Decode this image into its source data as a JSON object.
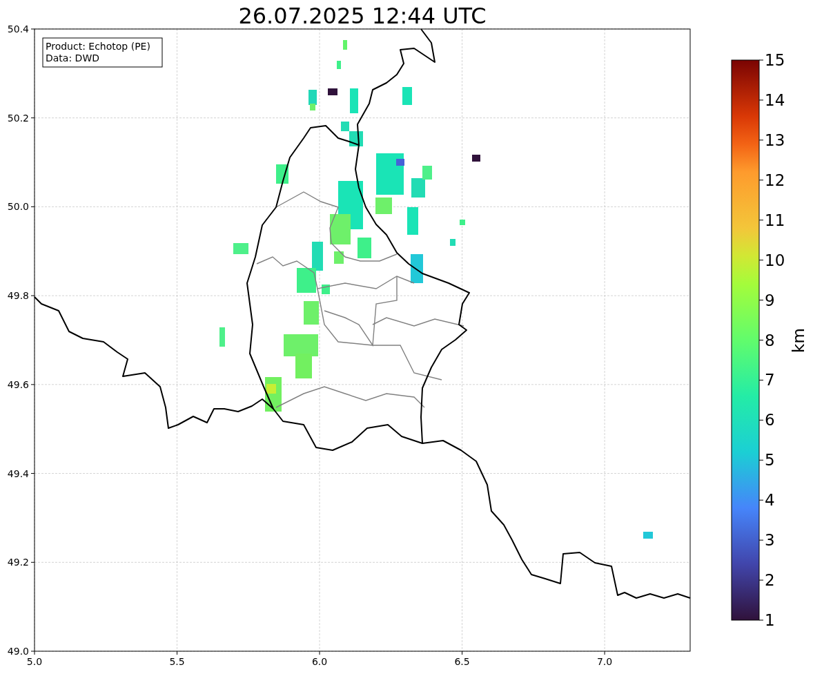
{
  "title": "26.07.2025 12:44 UTC",
  "legend": [
    "Product: Echotop (PE)",
    "Data: DWD"
  ],
  "x_ticks": [
    "5.0",
    "5.5",
    "6.0",
    "6.5",
    "7.0"
  ],
  "y_ticks": [
    "50.4",
    "50.2",
    "50.0",
    "49.8",
    "49.6",
    "49.4",
    "49.2",
    "49.0"
  ],
  "colorbar": {
    "ticks": [
      "15",
      "14",
      "13",
      "12",
      "11",
      "10",
      "9",
      "8",
      "7",
      "6",
      "5",
      "4",
      "3",
      "2",
      "1"
    ],
    "label": "km"
  }
}
